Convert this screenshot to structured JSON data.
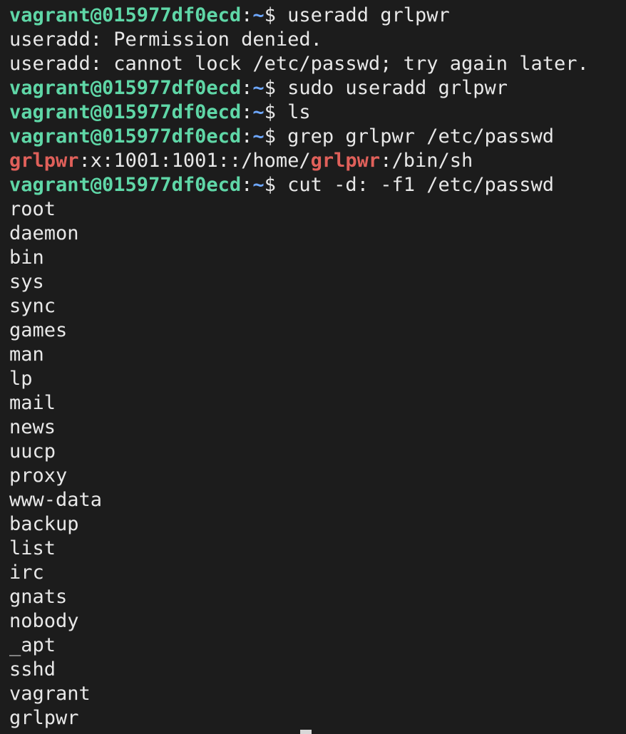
{
  "prompt": {
    "user_host": "vagrant@015977df0ecd",
    "colon": ":",
    "path": "~",
    "dollar": "$ "
  },
  "commands": {
    "cmd1": "useradd grlpwr",
    "cmd2": "sudo useradd grlpwr",
    "cmd3": "ls",
    "cmd4": "grep grlpwr /etc/passwd",
    "cmd5": "cut -d: -f1 /etc/passwd"
  },
  "outputs": {
    "err1": "useradd: Permission denied.",
    "err2": "useradd: cannot lock /etc/passwd; try again later.",
    "grep_match1": "grlpwr",
    "grep_mid": ":x:1001:1001::/home/",
    "grep_match2": "grlpwr",
    "grep_tail": ":/bin/sh"
  },
  "users": [
    "root",
    "daemon",
    "bin",
    "sys",
    "sync",
    "games",
    "man",
    "lp",
    "mail",
    "news",
    "uucp",
    "proxy",
    "www-data",
    "backup",
    "list",
    "irc",
    "gnats",
    "nobody",
    "_apt",
    "sshd",
    "vagrant",
    "grlpwr"
  ],
  "colors": {
    "background": "#1c1c1c",
    "text": "#e8e8e8",
    "user_host": "#5fd7a7",
    "path": "#6ea8ff",
    "match": "#e0605a"
  }
}
